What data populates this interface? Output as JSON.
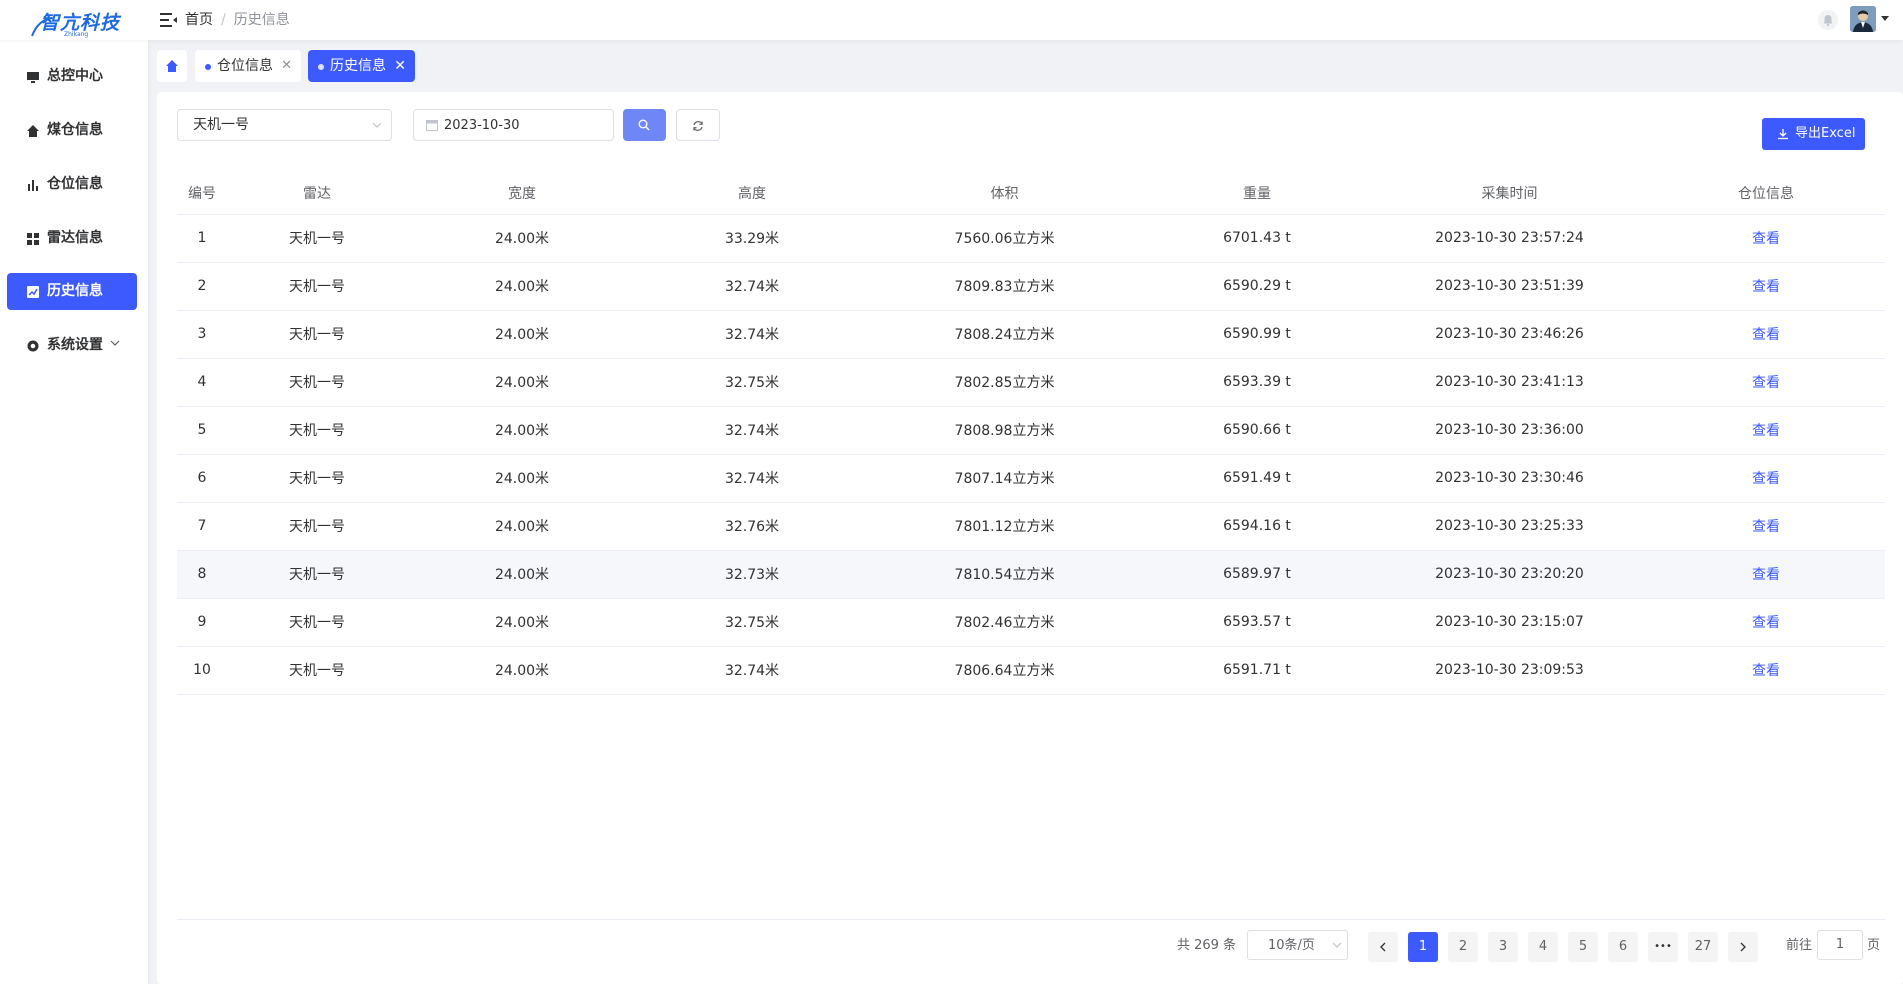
{
  "header": {
    "logo_text": "智亢科技",
    "logo_sub": "Zhikang",
    "breadcrumb_home": "首页",
    "breadcrumb_separator": "/",
    "breadcrumb_current": "历史信息"
  },
  "sidebar": {
    "items": [
      {
        "label": "总控中心",
        "icon": "monitor-icon"
      },
      {
        "label": "煤仓信息",
        "icon": "home-icon"
      },
      {
        "label": "仓位信息",
        "icon": "bar-chart-icon"
      },
      {
        "label": "雷达信息",
        "icon": "grid-icon"
      },
      {
        "label": "历史信息",
        "icon": "chart-card-icon",
        "active": true
      },
      {
        "label": "系统设置",
        "icon": "settings-icon"
      }
    ]
  },
  "tabs": {
    "items": [
      {
        "label": "仓位信息"
      },
      {
        "label": "历史信息",
        "active": true
      }
    ],
    "close_glyph": "✕"
  },
  "filters": {
    "radar_select": "天机一号",
    "date": "2023-10-30",
    "export_label": "导出Excel"
  },
  "table": {
    "columns": [
      "编号",
      "雷达",
      "宽度",
      "高度",
      "体积",
      "重量",
      "采集时间",
      "仓位信息"
    ],
    "rows": [
      {
        "id": "1",
        "radar": "天机一号",
        "width": "24.00米",
        "height": "33.29米",
        "volume": "7560.06立方米",
        "weight": "6701.43 t",
        "time": "2023-10-30 23:57:24",
        "action": "查看"
      },
      {
        "id": "2",
        "radar": "天机一号",
        "width": "24.00米",
        "height": "32.74米",
        "volume": "7809.83立方米",
        "weight": "6590.29 t",
        "time": "2023-10-30 23:51:39",
        "action": "查看"
      },
      {
        "id": "3",
        "radar": "天机一号",
        "width": "24.00米",
        "height": "32.74米",
        "volume": "7808.24立方米",
        "weight": "6590.99 t",
        "time": "2023-10-30 23:46:26",
        "action": "查看"
      },
      {
        "id": "4",
        "radar": "天机一号",
        "width": "24.00米",
        "height": "32.75米",
        "volume": "7802.85立方米",
        "weight": "6593.39 t",
        "time": "2023-10-30 23:41:13",
        "action": "查看"
      },
      {
        "id": "5",
        "radar": "天机一号",
        "width": "24.00米",
        "height": "32.74米",
        "volume": "7808.98立方米",
        "weight": "6590.66 t",
        "time": "2023-10-30 23:36:00",
        "action": "查看"
      },
      {
        "id": "6",
        "radar": "天机一号",
        "width": "24.00米",
        "height": "32.74米",
        "volume": "7807.14立方米",
        "weight": "6591.49 t",
        "time": "2023-10-30 23:30:46",
        "action": "查看"
      },
      {
        "id": "7",
        "radar": "天机一号",
        "width": "24.00米",
        "height": "32.76米",
        "volume": "7801.12立方米",
        "weight": "6594.16 t",
        "time": "2023-10-30 23:25:33",
        "action": "查看"
      },
      {
        "id": "8",
        "radar": "天机一号",
        "width": "24.00米",
        "height": "32.73米",
        "volume": "7810.54立方米",
        "weight": "6589.97 t",
        "time": "2023-10-30 23:20:20",
        "action": "查看"
      },
      {
        "id": "9",
        "radar": "天机一号",
        "width": "24.00米",
        "height": "32.75米",
        "volume": "7802.46立方米",
        "weight": "6593.57 t",
        "time": "2023-10-30 23:15:07",
        "action": "查看"
      },
      {
        "id": "10",
        "radar": "天机一号",
        "width": "24.00米",
        "height": "32.74米",
        "volume": "7806.64立方米",
        "weight": "6591.71 t",
        "time": "2023-10-30 23:09:53",
        "action": "查看"
      }
    ]
  },
  "pagination": {
    "total": "共 269 条",
    "page_size": "10条/页",
    "pages": [
      "1",
      "2",
      "3",
      "4",
      "5",
      "6"
    ],
    "ellipsis": "•••",
    "last_page": "27",
    "current": "1",
    "goto_label": "前往",
    "goto_value": "1",
    "page_suffix": "页"
  },
  "colors": {
    "primary": "#3d5afe",
    "search_button": "#6f86f7",
    "link": "#3d5afe"
  }
}
